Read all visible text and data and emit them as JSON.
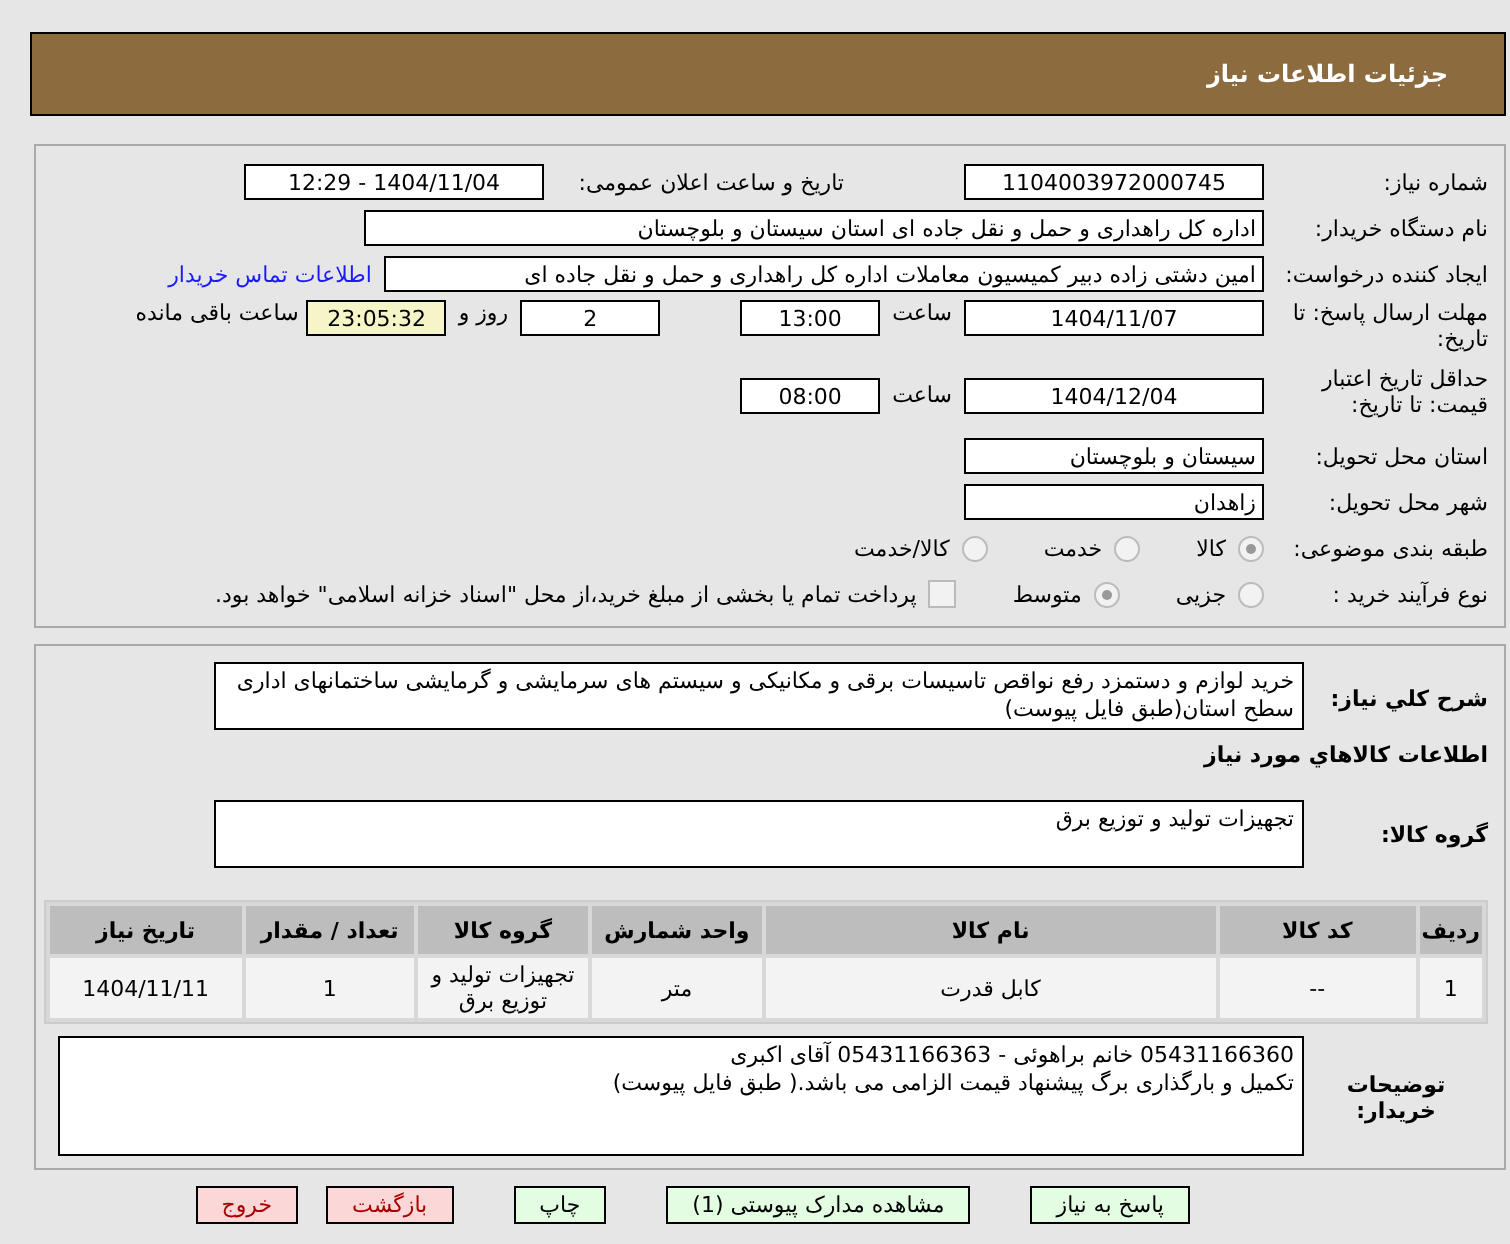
{
  "header": {
    "title": "جزئیات اطلاعات نیاز"
  },
  "need_number": {
    "label": "شماره نیاز:",
    "value": "1104003972000745"
  },
  "announce": {
    "label": "تاریخ و ساعت اعلان عمومی:",
    "value": "1404/11/04 - 12:29"
  },
  "buyer": {
    "label": "نام دستگاه خریدار:",
    "value": "اداره کل راهداری و حمل و نقل جاده ای استان سیستان و بلوچستان"
  },
  "creator": {
    "label": "ایجاد کننده درخواست:",
    "value": "امین دشتی زاده دبیر کمیسیون معاملات اداره کل راهداری و حمل و نقل جاده ای",
    "link": "اطلاعات تماس خریدار"
  },
  "deadline": {
    "label": "مهلت ارسال پاسخ: تا تاریخ:",
    "date": "1404/11/07",
    "time_label": "ساعت",
    "time": "13:00",
    "days": "2",
    "days_label": "روز و",
    "remaining": "23:05:32",
    "remaining_label": "ساعت باقی مانده"
  },
  "validity": {
    "label": "حداقل تاریخ اعتبار قیمت: تا تاریخ:",
    "date": "1404/12/04",
    "time_label": "ساعت",
    "time": "08:00"
  },
  "province": {
    "label": "استان محل تحویل:",
    "value": "سیستان و بلوچستان"
  },
  "city": {
    "label": "شهر محل تحویل:",
    "value": "زاهدان"
  },
  "category": {
    "label": "طبقه بندی موضوعی:",
    "options": [
      {
        "label": "کالا",
        "selected": true
      },
      {
        "label": "خدمت",
        "selected": false
      },
      {
        "label": "کالا/خدمت",
        "selected": false
      }
    ]
  },
  "process": {
    "label": "نوع فرآیند خرید :",
    "options": [
      {
        "label": "جزیی",
        "selected": false
      },
      {
        "label": "متوسط",
        "selected": true
      }
    ],
    "payment": {
      "label": "پرداخت تمام یا بخشی از مبلغ خرید،از محل \"اسناد خزانه اسلامی\" خواهد بود.",
      "checked": false
    }
  },
  "description": {
    "label": "شرح کلي نياز:",
    "value": "خرید لوازم و دستمزد رفع نواقص تاسیسات برقی و مکانیکی و سیستم های سرمایشی و گرمایشی ساختمانهای اداری سطح استان(طبق فایل پیوست)"
  },
  "goods_title": "اطلاعات کالاهاي مورد نياز",
  "goods_group": {
    "label": "گروه کالا:",
    "value": "تجهیزات تولید و توزیع برق"
  },
  "table": {
    "columns": [
      "ردیف",
      "کد کالا",
      "نام کالا",
      "واحد شمارش",
      "گروه کالا",
      "تعداد / مقدار",
      "تاریخ نیاز"
    ],
    "rows": [
      [
        "1",
        "--",
        "کابل قدرت",
        "متر",
        "تجهیزات تولید و توزیع برق",
        "1",
        "1404/11/11"
      ]
    ]
  },
  "notes": {
    "label": "توضیحات خریدار:",
    "lines": [
      "05431166360 خانم براهوئی - 05431166363 آقای اکبری",
      "تکمیل و بارگذاری برگ پیشنهاد قیمت الزامی می باشد.( طبق فایل پیوست)"
    ]
  },
  "buttons": [
    {
      "label": "پاسخ به نیاز",
      "kind": "green"
    },
    {
      "label": "مشاهده مدارک پیوستی (1)",
      "kind": "green"
    },
    {
      "label": "چاپ",
      "kind": "green"
    },
    {
      "label": "بازگشت",
      "kind": "red"
    },
    {
      "label": "خروج",
      "kind": "red"
    }
  ]
}
